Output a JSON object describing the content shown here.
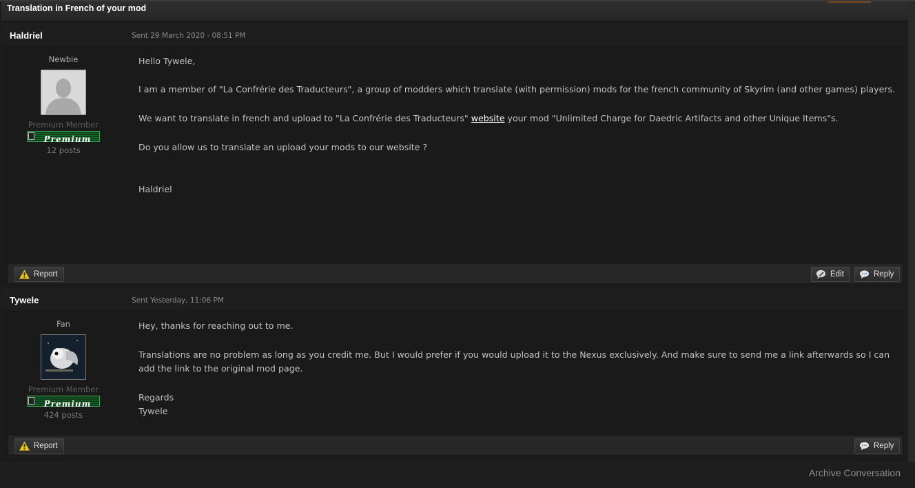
{
  "conversation": {
    "title": "Translation in French of your mod"
  },
  "messages": [
    {
      "author": "Haldriel",
      "sent": "Sent 29 March 2020 - 08:51 PM",
      "rank": "Newbie",
      "group": "Premium Member",
      "badge": "Premium",
      "posts": "12 posts",
      "avatar": "default-user-avatar",
      "paragraphs": {
        "p1": "Hello Tywele,",
        "p2": "I am a member of \"La Confrérie des Traducteurs\", a group of modders which translate (with permission) mods for the french community of Skyrim (and other games) players.",
        "p3_before": "We want to translate in french and upload to \"La Confrérie des Traducteurs\" ",
        "p3_link": "website",
        "p3_after": " your mod \"Unlimited Charge for Daedric Artifacts and other Unique Items\"s.",
        "p4": "Do you allow us to translate an upload your mods to our website ?",
        "p5": "Haldriel"
      },
      "buttons": {
        "report": "Report",
        "edit": "Edit",
        "reply": "Reply"
      }
    },
    {
      "author": "Tywele",
      "sent": "Sent Yesterday, 11:06 PM",
      "rank": "Fan",
      "group": "Premium Member",
      "badge": "Premium",
      "posts": "424 posts",
      "avatar": "owl-avatar",
      "paragraphs": {
        "p1": "Hey, thanks for reaching out to me.",
        "p2": "Translations are no problem as long as you credit me. But I would prefer if you would upload it to the Nexus exclusively. And make sure to send me a link afterwards so I can add the link to the original mod page.",
        "p3": "Regards",
        "p4": "Tywele"
      },
      "buttons": {
        "report": "Report",
        "reply": "Reply"
      }
    }
  ],
  "footer": {
    "archive": "Archive Conversation"
  },
  "colors": {
    "background": "#1c1c1c",
    "badge_green": "#1a6a2c",
    "warning_yellow": "#e8c21c",
    "text": "#c2c2c2"
  }
}
